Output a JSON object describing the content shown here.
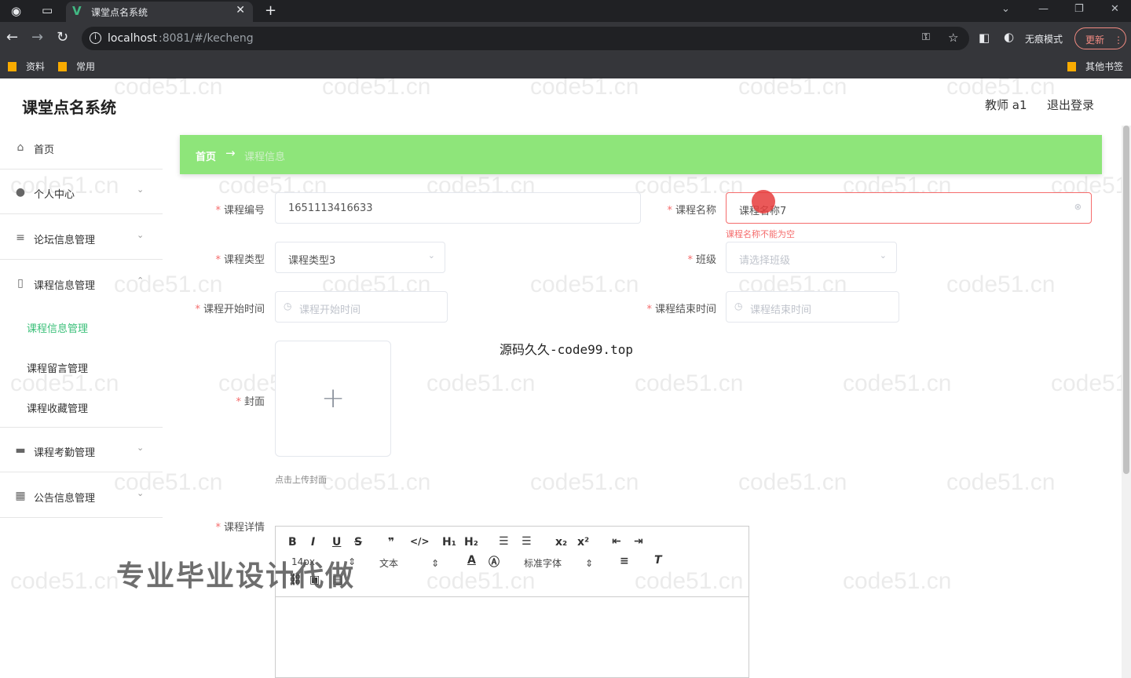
{
  "browser": {
    "tab_title": "课堂点名系统",
    "tab_favicon": "V",
    "url_host": "localhost",
    "url_path": ":8081/#/kecheng",
    "incognito_label": "无痕模式",
    "update_label": "更新",
    "bookmarks": [
      "资料",
      "常用"
    ],
    "other_bookmarks": "其他书签"
  },
  "app": {
    "title": "课堂点名系统",
    "user": "教师 a1",
    "logout": "退出登录"
  },
  "sidebar": {
    "items": [
      {
        "label": "首页",
        "icon": "home-icon"
      },
      {
        "label": "个人中心",
        "icon": "user-icon"
      },
      {
        "label": "论坛信息管理",
        "icon": "list-icon"
      },
      {
        "label": "课程信息管理",
        "icon": "doc-icon"
      },
      {
        "label": "课程考勤管理",
        "icon": "briefcase-icon"
      },
      {
        "label": "公告信息管理",
        "icon": "grid-icon"
      }
    ],
    "subitems": [
      {
        "label": "课程信息管理",
        "active": true
      },
      {
        "label": "课程留言管理"
      },
      {
        "label": "课程收藏管理"
      }
    ]
  },
  "breadcrumb": {
    "home": "首页",
    "arrow": "→",
    "current": "课程信息"
  },
  "form": {
    "course_no_label": "课程编号",
    "course_no_value": "1651113416633",
    "course_name_label": "课程名称",
    "course_name_value": "课程名称7",
    "course_name_error": "课程名称不能为空",
    "course_type_label": "课程类型",
    "course_type_value": "课程类型3",
    "class_label": "班级",
    "class_placeholder": "请选择班级",
    "start_label": "课程开始时间",
    "start_placeholder": "课程开始时间",
    "end_label": "课程结束时间",
    "end_placeholder": "课程结束时间",
    "cover_label": "封面",
    "cover_tip": "点击上传封面",
    "detail_label": "课程详情"
  },
  "editor": {
    "size": "14px",
    "block": "文本",
    "font": "标准字体"
  },
  "overlay": {
    "center_text": "源码久久-code99.top",
    "promo_text": "专业毕业设计代做",
    "watermark": "code51.cn"
  }
}
